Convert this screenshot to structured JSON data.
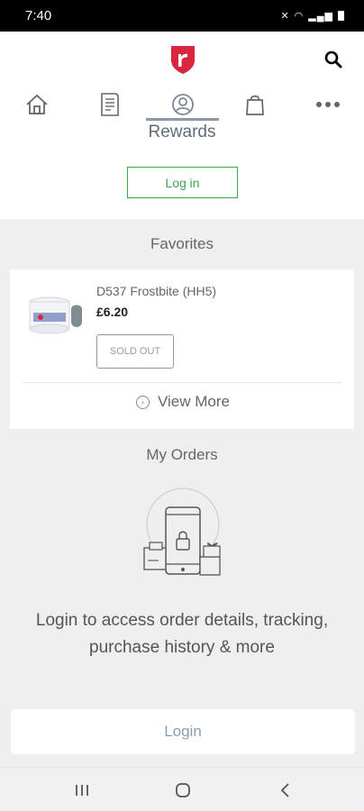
{
  "status_bar": {
    "time": "7:40"
  },
  "nav": {
    "items": [
      {
        "name": "home",
        "icon": "home-icon"
      },
      {
        "name": "orders",
        "icon": "receipt-icon"
      },
      {
        "name": "rewards",
        "icon": "account-icon"
      },
      {
        "name": "bag",
        "icon": "shopping-bag-icon"
      },
      {
        "name": "more",
        "icon": "more-dots-icon"
      }
    ],
    "active_label": "Rewards"
  },
  "account": {
    "login_label": "Log in"
  },
  "favorites": {
    "title": "Favorites",
    "item": {
      "name": "D537 Frostbite (HH5)",
      "price": "£6.20",
      "status": "SOLD OUT"
    },
    "view_more": "View More"
  },
  "orders": {
    "title": "My Orders",
    "message": "Login to access order details, tracking, purchase history & more",
    "login_label": "Login"
  },
  "colors": {
    "brand": "#d7263d",
    "accent_green": "#3aa94b",
    "nav_active": "#8e9aa8"
  }
}
